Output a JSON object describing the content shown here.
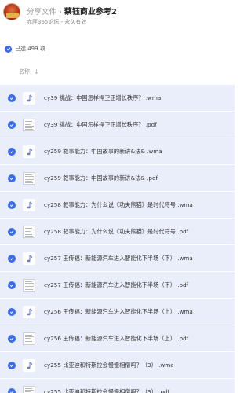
{
  "header": {
    "breadcrumb_root": "分享文件",
    "breadcrumb_sep": "›",
    "title": "蔡钰商业参考2",
    "subtitle": "赤匪365论坛 - 永久有效"
  },
  "selection": {
    "label": "已选 499 项"
  },
  "columns": {
    "name_label": "名称",
    "sort_icon": "arrow-down-icon"
  },
  "files": [
    {
      "name": "cy39 挑战：中国怎样捍卫正增长秩序？ .wma",
      "type": "wma"
    },
    {
      "name": "cy39 挑战：中国怎样捍卫正增长秩序？ .pdf",
      "type": "pdf"
    },
    {
      "name": "cy259 叙事能力：中国故事的新讲&法& .wma",
      "type": "wma"
    },
    {
      "name": "cy259 叙事能力：中国故事的新讲&法& .pdf",
      "type": "pdf"
    },
    {
      "name": "cy258 叙事能力：为什么说《功夫熊猫》是时代符号 .wma",
      "type": "wma"
    },
    {
      "name": "cy258 叙事能力：为什么说《功夫熊猫》是时代符号 .pdf",
      "type": "pdf"
    },
    {
      "name": "cy257 王传福：新能源汽车进入智能化下半场（下） .wma",
      "type": "wma"
    },
    {
      "name": "cy257 王传福：新能源汽车进入智能化下半场（下） .pdf",
      "type": "pdf"
    },
    {
      "name": "cy256 王传福：新能源汽车进入智能化下半场（上） .wma",
      "type": "wma"
    },
    {
      "name": "cy256 王传福：新能源汽车进入智能化下半场（上） .pdf",
      "type": "pdf"
    },
    {
      "name": "cy255 比亚迪和特斯拉会慢慢相僧吗？（3） .wma",
      "type": "wma"
    },
    {
      "name": "cy255 比亚迪和特斯拉会慢慢相僧吗？（3） .pdf",
      "type": "pdf"
    }
  ],
  "colors": {
    "accent": "#3a6cf0",
    "row_bg": "#eaeefb"
  }
}
